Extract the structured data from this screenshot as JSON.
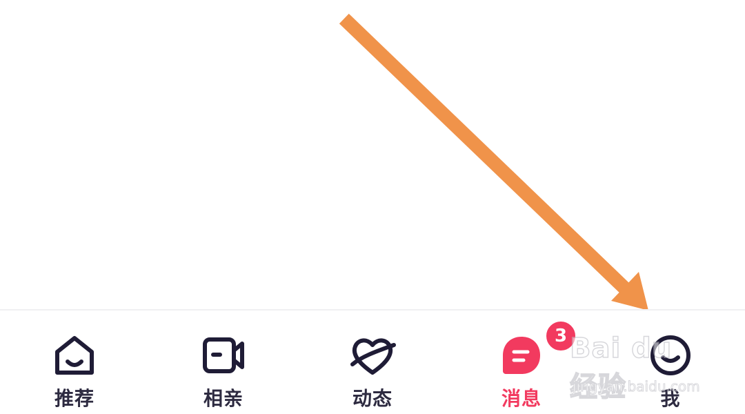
{
  "tabbar": {
    "tabs": [
      {
        "label": "推荐",
        "icon": "home-icon"
      },
      {
        "label": "相亲",
        "icon": "video-camera-icon"
      },
      {
        "label": "动态",
        "icon": "heart-planet-icon"
      },
      {
        "label": "消息",
        "icon": "chat-bubble-icon",
        "badge": "3",
        "active": true
      },
      {
        "label": "我",
        "icon": "smiley-face-icon"
      }
    ]
  },
  "annotation": {
    "icon": "orange-arrow-icon",
    "color": "#f0934a"
  },
  "watermark": {
    "brand": "Bai du 经验",
    "url": "jingyan.baidu.com"
  },
  "colors": {
    "icon_dark": "#1f1c36",
    "active": "#f23a5f",
    "label": "#2d2a40"
  }
}
